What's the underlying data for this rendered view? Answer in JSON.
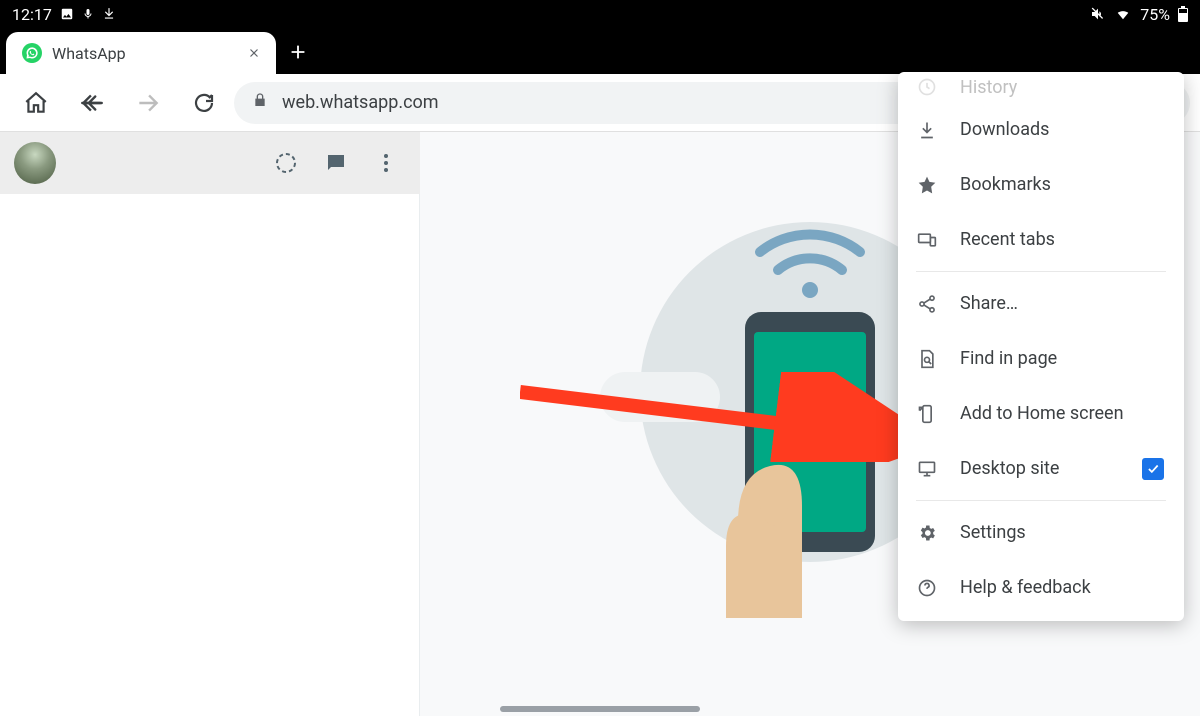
{
  "statusbar": {
    "time": "12:17",
    "battery_pct": "75%"
  },
  "tab": {
    "title": "WhatsApp"
  },
  "omnibox": {
    "url": "web.whatsapp.com"
  },
  "menu": {
    "history": "History",
    "downloads": "Downloads",
    "bookmarks": "Bookmarks",
    "recent_tabs": "Recent tabs",
    "share": "Share…",
    "find_in_page": "Find in page",
    "add_to_home": "Add to Home screen",
    "desktop_site": "Desktop site",
    "desktop_site_checked": true,
    "settings": "Settings",
    "help": "Help & feedback"
  }
}
